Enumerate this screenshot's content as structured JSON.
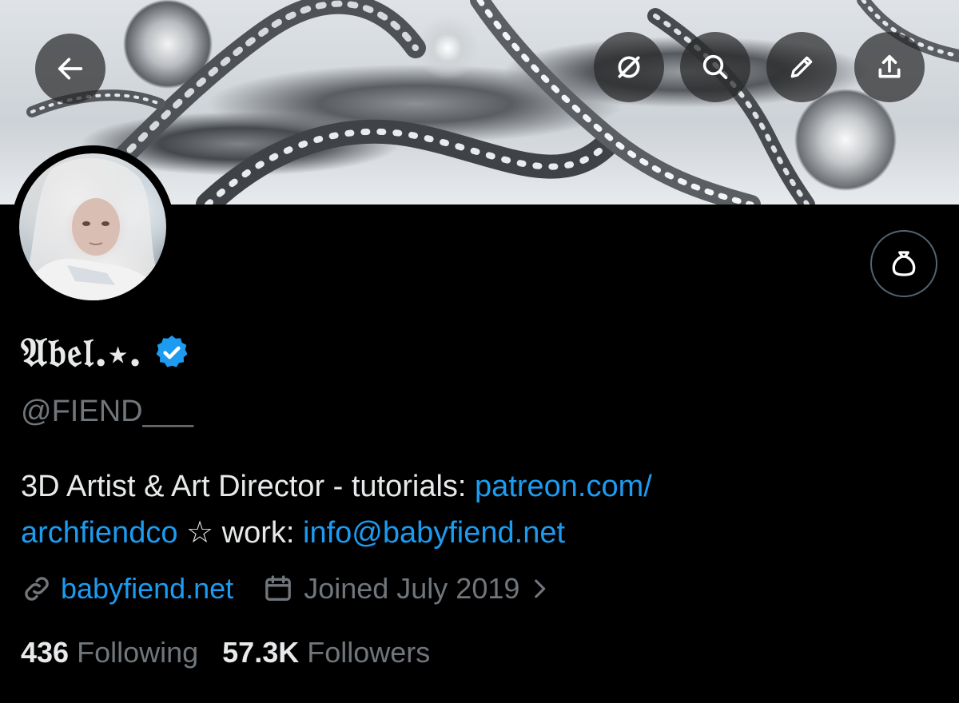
{
  "profile": {
    "display_name": "𝔄𝔟𝔢𝔩.⋆.",
    "handle": "@FIEND___",
    "bio": {
      "text_1": "3D Artist & Art Director - tutorials: ",
      "link_1": "patreon.com/archfiendco",
      "link_1_line1": "patreon.com/",
      "link_1_line2": "archfiendco",
      "text_2": " ☆ work: ",
      "link_2": "info@babyfiend.net"
    },
    "website": "babyfiend.net",
    "joined": "Joined July 2019",
    "following_count": "436",
    "following_label": "Following",
    "followers_count": "57.3K",
    "followers_label": "Followers"
  },
  "header_actions": {
    "back": "back-arrow-icon",
    "grok": "grok-icon",
    "search": "search-icon",
    "edit": "pencil-icon",
    "share": "share-icon"
  },
  "tip": "money-bag-icon",
  "colors": {
    "accent": "#1d9bf0",
    "secondary_text": "#71767b",
    "primary_text": "#e7e9ea",
    "background": "#000000"
  }
}
